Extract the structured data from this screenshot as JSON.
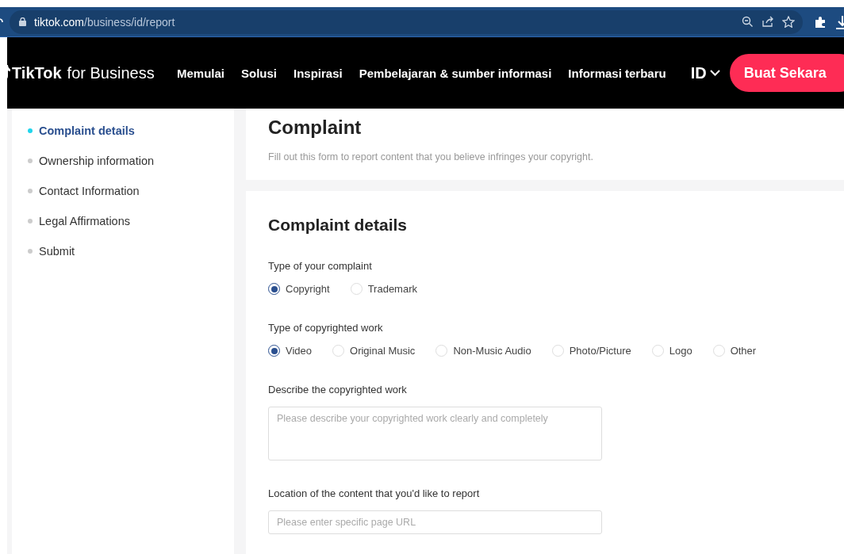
{
  "browser": {
    "url_host": "tiktok.com",
    "url_path": "/business/id/report"
  },
  "header": {
    "logo": "TikTok",
    "logo_suffix": "for Business",
    "nav": [
      "Memulai",
      "Solusi",
      "Inspirasi",
      "Pembelajaran & sumber informasi",
      "Informasi terbaru"
    ],
    "language": "ID",
    "cta": "Buat Sekara"
  },
  "steps": [
    {
      "label": "Complaint details",
      "selected": true
    },
    {
      "label": "Ownership information",
      "selected": false
    },
    {
      "label": "Contact Information",
      "selected": false
    },
    {
      "label": "Legal Affirmations",
      "selected": false
    },
    {
      "label": "Submit",
      "selected": false
    }
  ],
  "intro": {
    "title": "Complaint",
    "subtitle": "Fill out this form to report content that you believe infringes your copyright."
  },
  "form": {
    "title": "Complaint details",
    "fields": [
      {
        "kind": "radio",
        "label": "Type of your complaint",
        "options": [
          {
            "label": "Copyright",
            "selected": true
          },
          {
            "label": "Trademark",
            "selected": false
          }
        ]
      },
      {
        "kind": "radio",
        "label": "Type of copyrighted work",
        "options": [
          {
            "label": "Video",
            "selected": true
          },
          {
            "label": "Original Music",
            "selected": false
          },
          {
            "label": "Non-Music Audio",
            "selected": false
          },
          {
            "label": "Photo/Picture",
            "selected": false
          },
          {
            "label": "Logo",
            "selected": false
          },
          {
            "label": "Other",
            "selected": false
          }
        ]
      },
      {
        "kind": "textarea",
        "label": "Describe the copyrighted work",
        "placeholder": "Please describe your copyrighted work clearly and completely"
      },
      {
        "kind": "input",
        "label": "Location of the content that you'd like to report",
        "placeholder": "Please enter specific page URL"
      }
    ]
  }
}
